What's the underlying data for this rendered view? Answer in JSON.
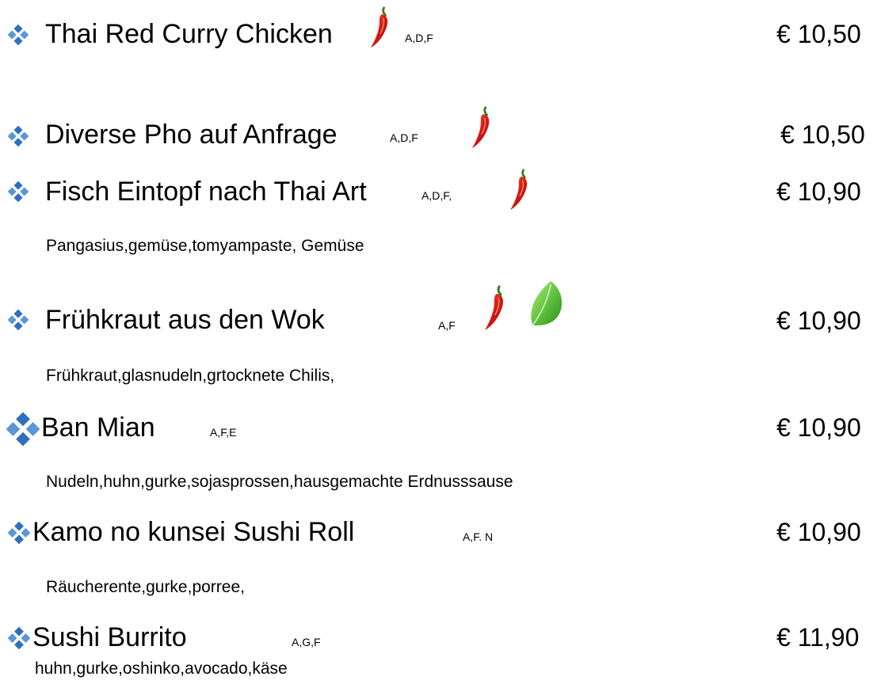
{
  "menu": {
    "items": [
      {
        "name": "Thai Red Curry Chicken",
        "codes": "A,D,F",
        "price": "€ 10,50",
        "description": "",
        "spicy": true,
        "vegetarian": false
      },
      {
        "name": "Diverse Pho auf Anfrage",
        "codes": "A,D,F",
        "price": "€ 10,50",
        "description": "",
        "spicy": true,
        "vegetarian": false
      },
      {
        "name": "Fisch Eintopf nach Thai Art",
        "codes": "A,D,F,",
        "price": "€ 10,90",
        "description": "Pangasius,gemüse,tomyampaste, Gemüse",
        "spicy": true,
        "vegetarian": false
      },
      {
        "name": "Frühkraut aus den Wok",
        "codes": "A,F",
        "price": "€ 10,90",
        "description": "Frühkraut,glasnudeln,grtocknete Chilis,",
        "spicy": true,
        "vegetarian": true
      },
      {
        "name": "Ban Mian",
        "codes": "A,F,E",
        "price": "€ 10,90",
        "description": "Nudeln,huhn,gurke,sojasprossen,hausgemachte Erdnusssause",
        "spicy": false,
        "vegetarian": false
      },
      {
        "name": "Kamo no kunsei Sushi Roll",
        "codes": "A,F. N",
        "price": "€ 10,90",
        "description": "Räucherente,gurke,porree,",
        "spicy": false,
        "vegetarian": false
      },
      {
        "name": "Sushi Burrito",
        "codes": "A,G,F",
        "price": "€ 11,90",
        "description": "huhn,gurke,oshinko,avocado,käse",
        "spicy": false,
        "vegetarian": false
      }
    ]
  },
  "icons": {
    "bullet": "diamond-bullet-icon",
    "spicy": "chili-pepper-icon",
    "vegetarian": "green-leaf-icon"
  },
  "colors": {
    "bullet": "#3f7fc9",
    "chili": "#d41a12",
    "leaf": "#4caf32"
  }
}
